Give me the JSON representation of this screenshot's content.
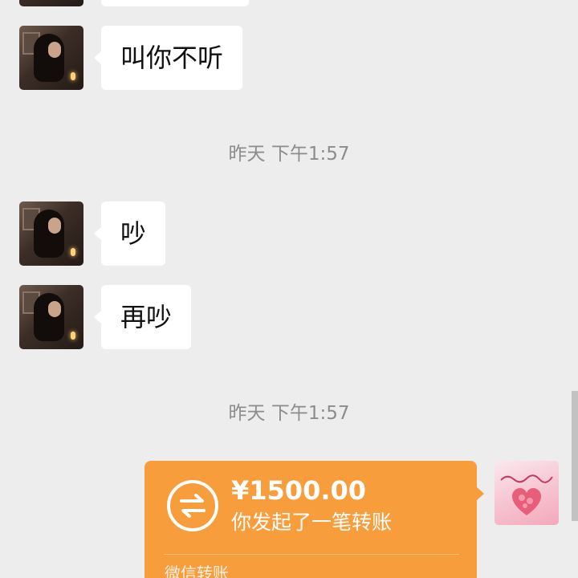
{
  "messages": [
    {
      "text": "叫你不听"
    },
    {
      "text": "吵"
    },
    {
      "text": "再吵"
    }
  ],
  "timestamps": [
    "昨天 下午1:57",
    "昨天 下午1:57"
  ],
  "transfer": {
    "amount": "¥1500.00",
    "description": "你发起了一笔转账",
    "footer": "微信转账",
    "background_color": "#f79d3c"
  },
  "colors": {
    "chat_background": "#ededed",
    "bubble_background": "#ffffff",
    "timestamp_text": "#8c8c8c"
  },
  "icons": {
    "transfer": "transfer-arrows-icon"
  }
}
